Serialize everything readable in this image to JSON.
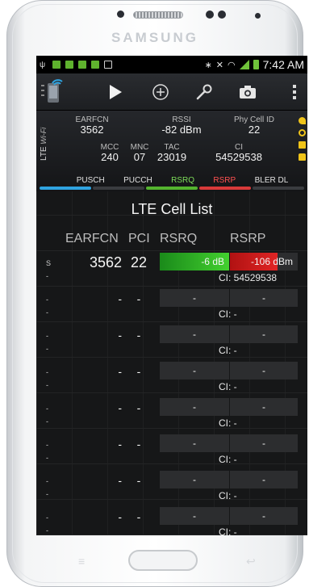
{
  "device": {
    "brand": "SAMSUNG"
  },
  "statusbar": {
    "time": "7:42 AM"
  },
  "info": {
    "earfcn_label": "EARFCN",
    "earfcn": "3562",
    "rssi_label": "RSSI",
    "rssi": "-82 dBm",
    "phy_cell_id_label": "Phy Cell ID",
    "phy_cell_id": "22",
    "mcc_label": "MCC",
    "mcc": "240",
    "mnc_label": "MNC",
    "mnc": "07",
    "tac_label": "TAC",
    "tac": "23019",
    "ci_label": "CI",
    "ci": "54529538",
    "network_type": "LTE",
    "network_sub": "Wi-Fi"
  },
  "tabs": [
    {
      "label": "PUSCH"
    },
    {
      "label": "PUCCH"
    },
    {
      "label": "RSRQ"
    },
    {
      "label": "RSRP"
    },
    {
      "label": "BLER DL"
    }
  ],
  "cell_list": {
    "title": "LTE Cell List",
    "headers": {
      "earfcn": "EARFCN",
      "pci": "PCI",
      "rsrq": "RSRQ",
      "rsrp": "RSRP"
    },
    "rows": [
      {
        "mark": "S",
        "earfcn": "3562",
        "pci": "22",
        "rsrq": "-6 dB",
        "rsrp": "-106 dBm",
        "sep": "-",
        "ci": "CI: 54529538"
      },
      {
        "mark": "-",
        "earfcn": "-",
        "pci": "-",
        "rsrq": "-",
        "rsrp": "-",
        "sep": "-",
        "ci": "CI: -"
      },
      {
        "mark": "-",
        "earfcn": "-",
        "pci": "-",
        "rsrq": "-",
        "rsrp": "-",
        "sep": "-",
        "ci": "CI: -"
      },
      {
        "mark": "-",
        "earfcn": "-",
        "pci": "-",
        "rsrq": "-",
        "rsrp": "-",
        "sep": "-",
        "ci": "CI: -"
      },
      {
        "mark": "-",
        "earfcn": "-",
        "pci": "-",
        "rsrq": "-",
        "rsrp": "-",
        "sep": "-",
        "ci": "CI: -"
      },
      {
        "mark": "-",
        "earfcn": "-",
        "pci": "-",
        "rsrq": "-",
        "rsrp": "-",
        "sep": "-",
        "ci": "CI: -"
      },
      {
        "mark": "-",
        "earfcn": "-",
        "pci": "-",
        "rsrq": "-",
        "rsrp": "-",
        "sep": "-",
        "ci": "CI: -"
      },
      {
        "mark": "-",
        "earfcn": "-",
        "pci": "-",
        "rsrq": "-",
        "rsrp": "-",
        "sep": "-",
        "ci": "CI: -"
      }
    ]
  },
  "colors": {
    "rsrq_good": "#43d12f",
    "rsrp_bad": "#e02525",
    "tab_blue": "#2fa3e0"
  },
  "icons": [
    "app-signal-icon",
    "play-icon",
    "add-icon",
    "wrench-icon",
    "camera-icon",
    "overflow-menu-icon"
  ]
}
